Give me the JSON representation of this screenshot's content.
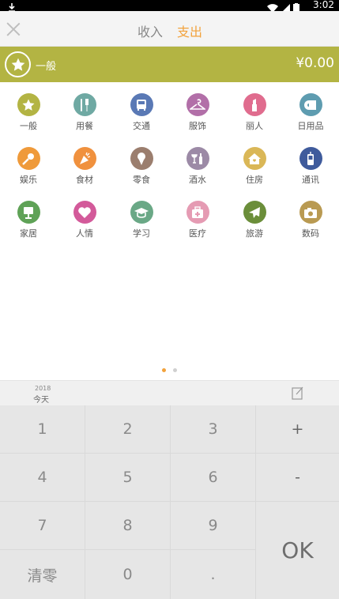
{
  "status_bar": {
    "time": "3:02",
    "download_icon": "download-icon",
    "wifi_icon": "wifi-icon",
    "signal_icon": "signal-icon",
    "battery_icon": "battery-icon"
  },
  "header": {
    "tabs": [
      {
        "label": "收入"
      },
      {
        "label": "支出"
      }
    ],
    "active_tab": "支出"
  },
  "selected": {
    "name": "一般",
    "amount": "¥0.00",
    "color": "#b3b443"
  },
  "categories": [
    {
      "label": "一般",
      "icon": "star-icon",
      "color": "#b3b443"
    },
    {
      "label": "用餐",
      "icon": "cutlery-icon",
      "color": "#6fa9a3"
    },
    {
      "label": "交通",
      "icon": "bus-icon",
      "color": "#5a79b5"
    },
    {
      "label": "服饰",
      "icon": "hanger-icon",
      "color": "#b26fa8"
    },
    {
      "label": "丽人",
      "icon": "lipstick-icon",
      "color": "#e06c8e"
    },
    {
      "label": "日用品",
      "icon": "tissue-icon",
      "color": "#5e9cb0"
    },
    {
      "label": "娱乐",
      "icon": "microphone-icon",
      "color": "#ef9a3a"
    },
    {
      "label": "食材",
      "icon": "carrot-icon",
      "color": "#f0913e"
    },
    {
      "label": "零食",
      "icon": "icecream-icon",
      "color": "#9b7e6e"
    },
    {
      "label": "酒水",
      "icon": "wine-icon",
      "color": "#9c8aa6"
    },
    {
      "label": "住房",
      "icon": "house-icon",
      "color": "#dab757"
    },
    {
      "label": "通讯",
      "icon": "phone-icon",
      "color": "#3f5b9c"
    },
    {
      "label": "家居",
      "icon": "lamp-icon",
      "color": "#5fa257"
    },
    {
      "label": "人情",
      "icon": "heart-icon",
      "color": "#d35a9a"
    },
    {
      "label": "学习",
      "icon": "graduation-cap-icon",
      "color": "#6aa886"
    },
    {
      "label": "医疗",
      "icon": "medical-kit-icon",
      "color": "#e59bb3"
    },
    {
      "label": "旅游",
      "icon": "airplane-icon",
      "color": "#6b8e3a"
    },
    {
      "label": "数码",
      "icon": "camera-icon",
      "color": "#b99a52"
    }
  ],
  "pager": {
    "active_color": "#f2a23c",
    "inactive_color": "#d0d0d0"
  },
  "date_row": {
    "year": "2018",
    "day": "今天",
    "note_icon": "edit-note-icon"
  },
  "keypad": {
    "keys": [
      "1",
      "2",
      "3",
      "+",
      "4",
      "5",
      "6",
      "-",
      "7",
      "8",
      "9",
      "清零",
      "0",
      "."
    ],
    "ok_label": "OK"
  }
}
